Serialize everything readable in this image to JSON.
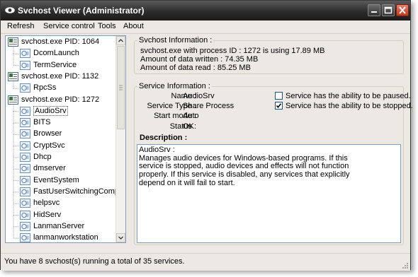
{
  "window": {
    "title": "Svchost Viewer (Administrator)"
  },
  "menu": [
    "Refresh",
    "Service control",
    "Tools",
    "About"
  ],
  "tree": [
    {
      "label": "svchost.exe PID: 1064",
      "level": 0,
      "icon": "process-icon"
    },
    {
      "label": "DcomLaunch",
      "level": 1,
      "icon": "service-icon"
    },
    {
      "label": "TermService",
      "level": 1,
      "icon": "service-icon"
    },
    {
      "label": "svchost.exe PID: 1132",
      "level": 0,
      "icon": "process-icon"
    },
    {
      "label": "RpcSs",
      "level": 1,
      "icon": "service-icon"
    },
    {
      "label": "svchost.exe PID: 1272",
      "level": 0,
      "icon": "process-icon"
    },
    {
      "label": "AudioSrv",
      "level": 1,
      "icon": "service-icon",
      "selected": true
    },
    {
      "label": "BITS",
      "level": 1,
      "icon": "service-icon"
    },
    {
      "label": "Browser",
      "level": 1,
      "icon": "service-icon"
    },
    {
      "label": "CryptSvc",
      "level": 1,
      "icon": "service-icon"
    },
    {
      "label": "Dhcp",
      "level": 1,
      "icon": "service-icon"
    },
    {
      "label": "dmserver",
      "level": 1,
      "icon": "service-icon"
    },
    {
      "label": "EventSystem",
      "level": 1,
      "icon": "service-icon"
    },
    {
      "label": "FastUserSwitchingCompatibilit",
      "level": 1,
      "icon": "service-icon"
    },
    {
      "label": "helpsvc",
      "level": 1,
      "icon": "service-icon"
    },
    {
      "label": "HidServ",
      "level": 1,
      "icon": "service-icon"
    },
    {
      "label": "LanmanServer",
      "level": 1,
      "icon": "service-icon"
    },
    {
      "label": "lanmanworkstation",
      "level": 1,
      "icon": "service-icon"
    }
  ],
  "svchost_info": {
    "title": "Svchost Information :",
    "lines": [
      "svchost.exe with process ID : 1272 is using 17.89 MB",
      "Amount of data written : 74.35 MB",
      "Amount of data read : 85.25 MB"
    ]
  },
  "service_info": {
    "title": "Service Information :",
    "fields": [
      {
        "label": "Name :",
        "value": "AudioSrv"
      },
      {
        "label": "Service Type :",
        "value": "Share Process"
      },
      {
        "label": "Start mode :",
        "value": "Auto"
      },
      {
        "label": "Status :",
        "value": "OK"
      }
    ],
    "checkboxes": [
      {
        "label": "Service has the ability to be paused.",
        "checked": false
      },
      {
        "label": "Service has the ability to be stopped.",
        "checked": true
      }
    ],
    "description_label": "Description :"
  },
  "description": {
    "name_line": "AudioSrv :",
    "text": "Manages audio devices for Windows-based programs.  If this service is stopped, audio devices and effects will not function properly.  If this service is disabled, any services that explicitly depend on it will fail to start."
  },
  "status": "You have 8 svchost(s) running a total of 35 services."
}
